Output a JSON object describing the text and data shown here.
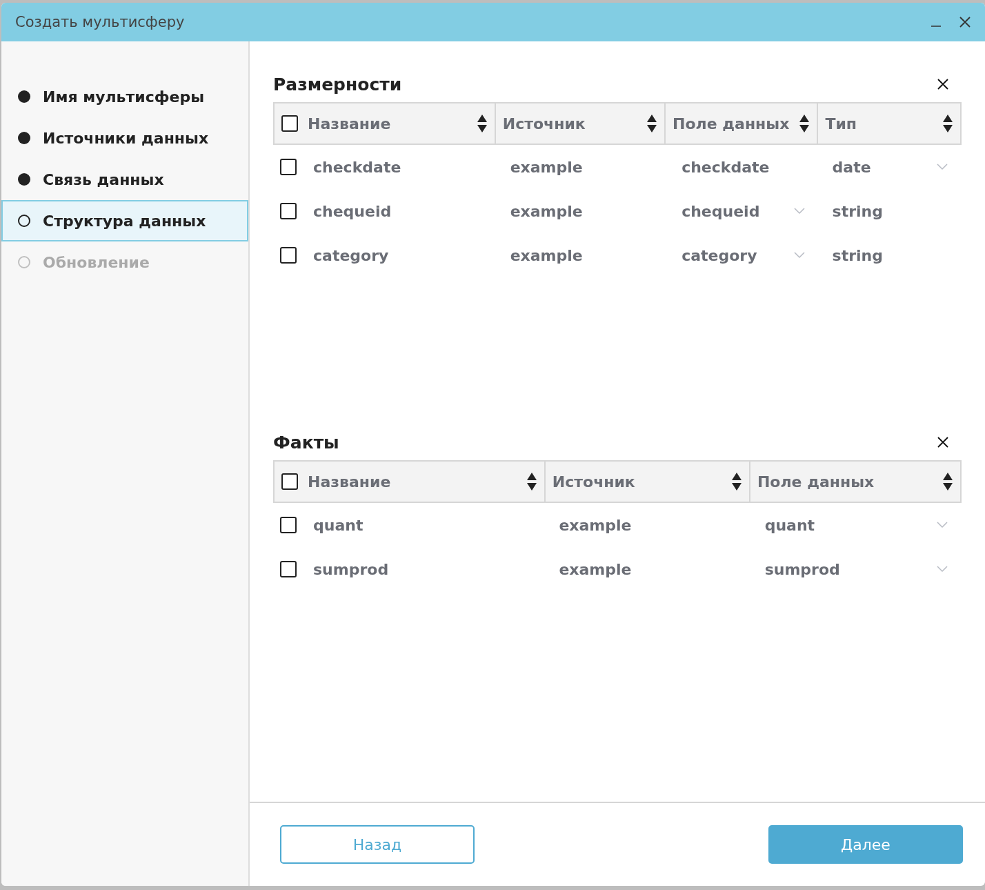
{
  "window": {
    "title": "Создать мультисферу"
  },
  "steps": [
    {
      "label": "Имя мультисферы",
      "completed": true,
      "disabled": false,
      "selected": false
    },
    {
      "label": "Источники данных",
      "completed": true,
      "disabled": false,
      "selected": false
    },
    {
      "label": "Связь данных",
      "completed": true,
      "disabled": false,
      "selected": false
    },
    {
      "label": "Структура данных",
      "completed": false,
      "disabled": false,
      "selected": true
    },
    {
      "label": "Обновление",
      "completed": false,
      "disabled": true,
      "selected": false
    }
  ],
  "sections": [
    {
      "title": "Размерности",
      "all_checked": false,
      "columns": [
        "Название",
        "Источник",
        "Поле данных",
        "Тип"
      ],
      "rows": [
        {
          "checked": false,
          "cells": [
            {
              "text": "checkdate",
              "dropdown": false
            },
            {
              "text": "example",
              "dropdown": false
            },
            {
              "text": "checkdate",
              "dropdown": false
            },
            {
              "text": "date",
              "dropdown": true
            }
          ]
        },
        {
          "checked": false,
          "cells": [
            {
              "text": "chequeid",
              "dropdown": false
            },
            {
              "text": "example",
              "dropdown": false
            },
            {
              "text": "chequeid",
              "dropdown": true
            },
            {
              "text": "string",
              "dropdown": false
            }
          ]
        },
        {
          "checked": false,
          "cells": [
            {
              "text": "category",
              "dropdown": false
            },
            {
              "text": "example",
              "dropdown": false
            },
            {
              "text": "category",
              "dropdown": true
            },
            {
              "text": "string",
              "dropdown": false
            }
          ]
        }
      ]
    },
    {
      "title": "Факты",
      "all_checked": false,
      "columns": [
        "Название",
        "Источник",
        "Поле данных"
      ],
      "rows": [
        {
          "checked": false,
          "cells": [
            {
              "text": "quant",
              "dropdown": false
            },
            {
              "text": "example",
              "dropdown": false
            },
            {
              "text": "quant",
              "dropdown": true
            }
          ]
        },
        {
          "checked": false,
          "cells": [
            {
              "text": "sumprod",
              "dropdown": false
            },
            {
              "text": "example",
              "dropdown": false
            },
            {
              "text": "sumprod",
              "dropdown": true
            }
          ]
        }
      ]
    }
  ],
  "buttons": {
    "back": "Назад",
    "next": "Далее"
  }
}
